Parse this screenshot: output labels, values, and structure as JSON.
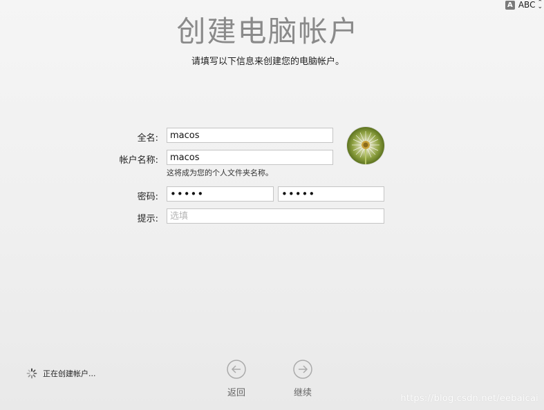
{
  "input_source": {
    "icon_letter": "A",
    "label": "ABC"
  },
  "header": {
    "title": "创建电脑帐户",
    "subtitle": "请填写以下信息来创建您的电脑帐户。"
  },
  "form": {
    "full_name": {
      "label": "全名:",
      "value": "macos"
    },
    "account_name": {
      "label": "帐户名称:",
      "value": "macos",
      "hint": "这将成为您的个人文件夹名称。"
    },
    "password": {
      "label": "密码:",
      "value": "•••••",
      "verify_value": "•••••"
    },
    "password_hint": {
      "label": "提示:",
      "value": "",
      "placeholder": "选填"
    },
    "avatar": "dandelion-photo"
  },
  "status": {
    "text": "正在创建帐户..."
  },
  "nav": {
    "back_label": "返回",
    "continue_label": "继续"
  },
  "watermark": "https://blog.csdn.net/eebaicai"
}
